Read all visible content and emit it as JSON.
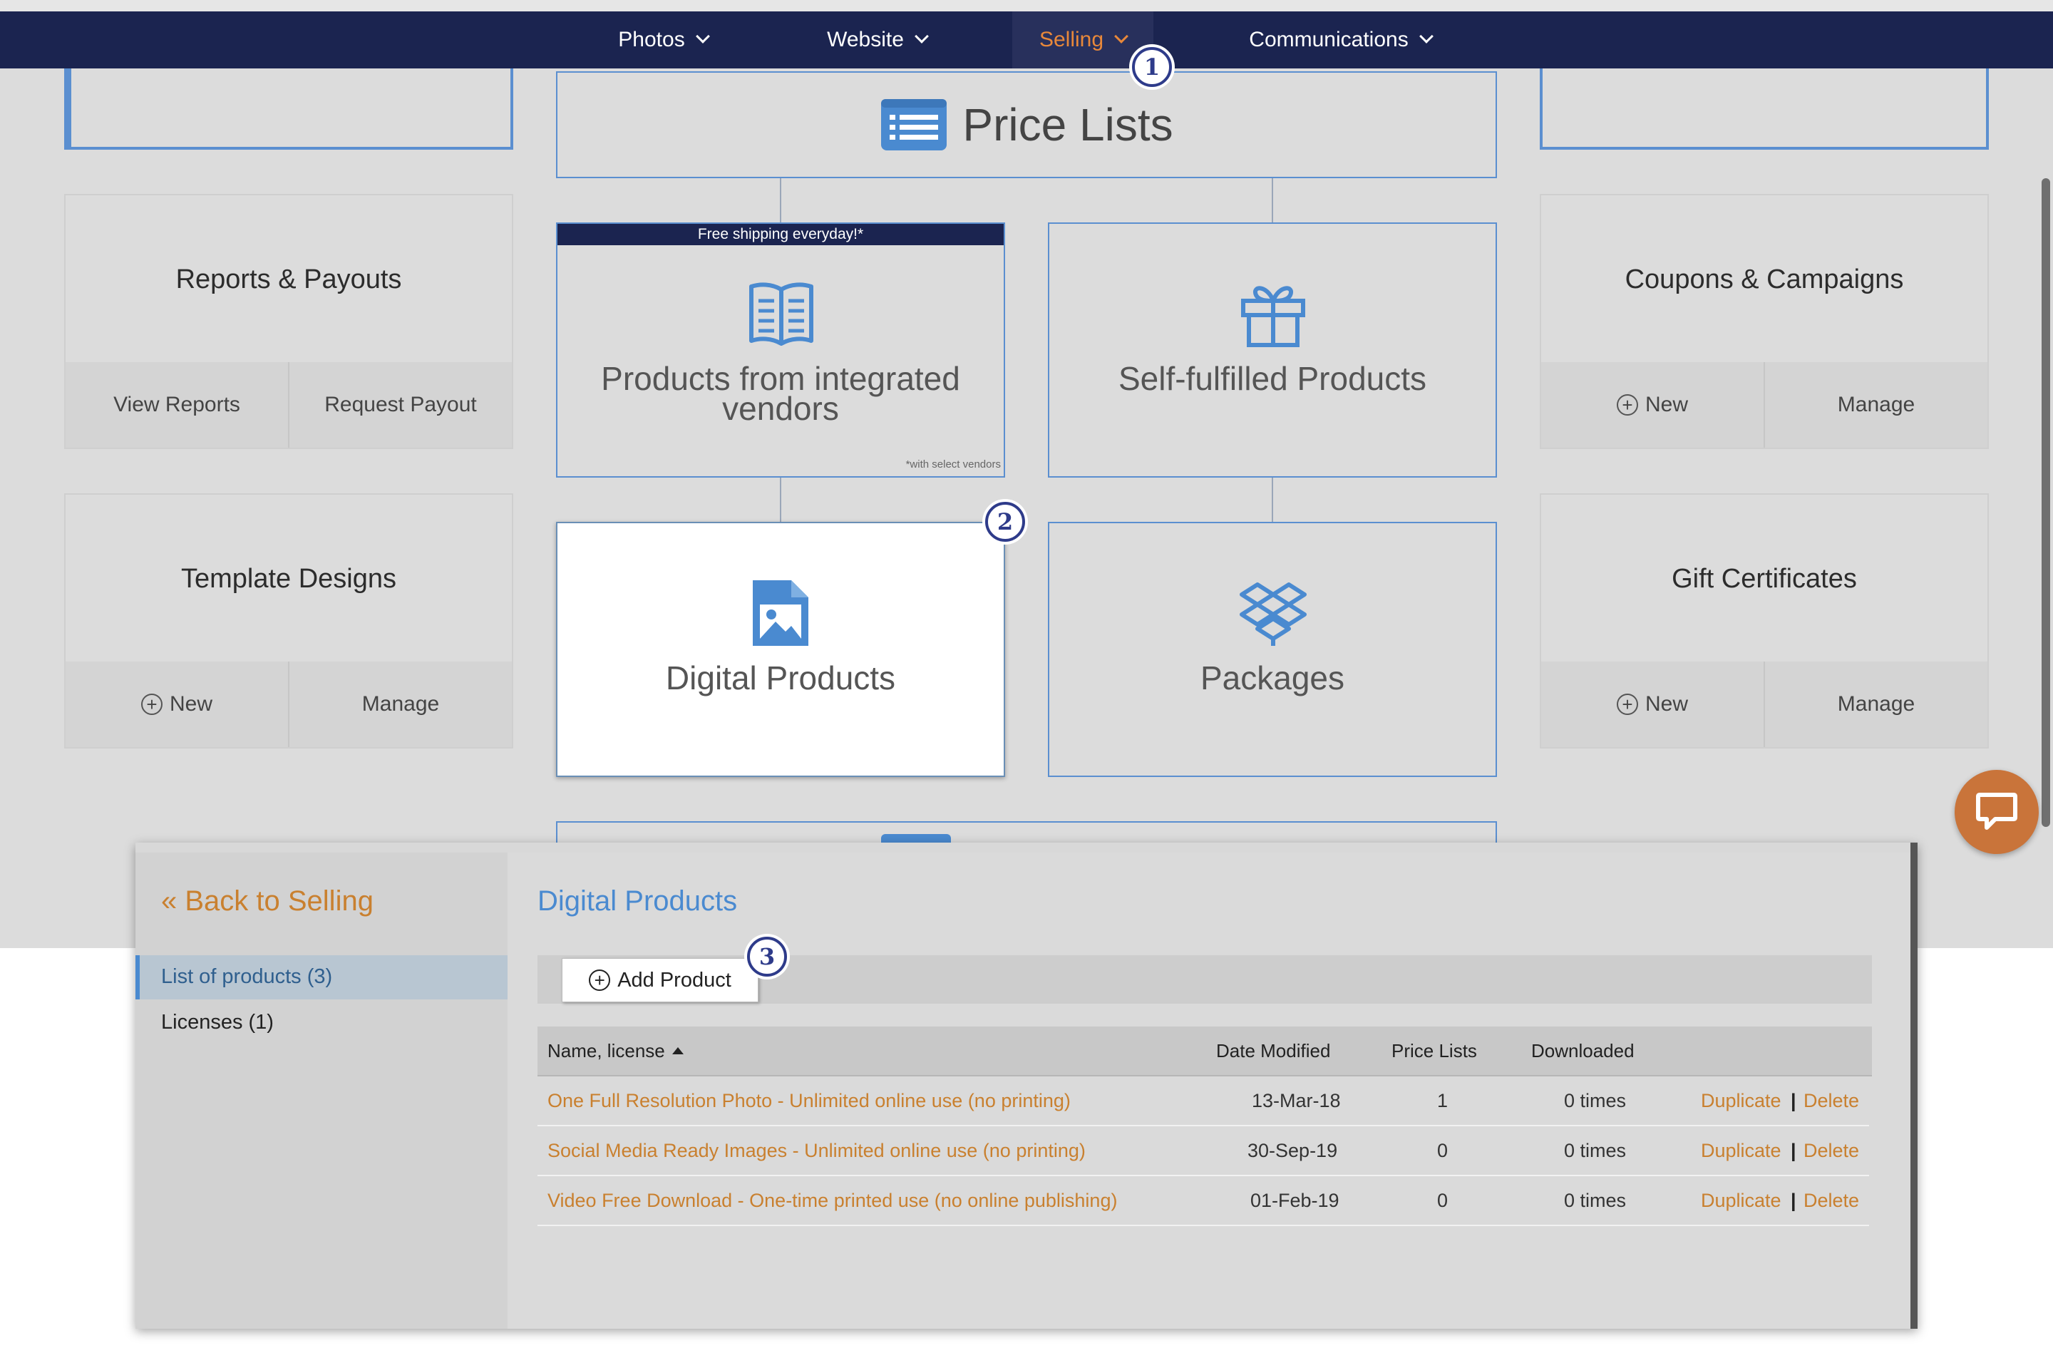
{
  "nav": {
    "items": [
      {
        "label": "Photos"
      },
      {
        "label": "Website"
      },
      {
        "label": "Selling"
      },
      {
        "label": "Communications"
      }
    ],
    "active": "Selling",
    "active_color": "#e8883a",
    "bar_color": "#1b2450"
  },
  "steps": [
    "1",
    "2",
    "3"
  ],
  "price_lists": {
    "title": "Price Lists",
    "icon": "list-icon"
  },
  "cards": {
    "integrated": {
      "banner": "Free shipping everyday!*",
      "label": "Products from integrated vendors",
      "footnote": "*with select vendors",
      "icon": "book-icon"
    },
    "self_fulfilled": {
      "label": "Self-fulfilled Products",
      "icon": "gift-icon"
    },
    "digital": {
      "label": "Digital Products",
      "icon": "image-file-icon"
    },
    "packages": {
      "label": "Packages",
      "icon": "dropbox-icon"
    }
  },
  "left": {
    "reports": {
      "title": "Reports & Payouts",
      "action1": "View Reports",
      "action2": "Request Payout"
    },
    "templates": {
      "title": "Template Designs",
      "action1": "New",
      "action2": "Manage"
    }
  },
  "right": {
    "coupons": {
      "title": "Coupons & Campaigns",
      "action1": "New",
      "action2": "Manage"
    },
    "gifts": {
      "title": "Gift Certificates",
      "action1": "New",
      "action2": "Manage"
    }
  },
  "panel": {
    "back_link": "« Back to Selling",
    "sidebar": [
      {
        "label": "List of products (3)"
      },
      {
        "label": "Licenses (1)"
      }
    ],
    "title": "Digital Products",
    "add_button": "Add Product",
    "columns": [
      "Name, license",
      "Date Modified",
      "Price Lists",
      "Downloaded"
    ],
    "rows": [
      {
        "name": "One Full Resolution Photo - Unlimited online use (no printing)",
        "date": "13-Mar-18",
        "price_lists": "1",
        "downloaded": "0 times",
        "duplicate": "Duplicate",
        "sep": "|",
        "delete": "Delete"
      },
      {
        "name": "Social Media Ready Images - Unlimited online use (no printing)",
        "date": "30-Sep-19",
        "price_lists": "0",
        "downloaded": "0 times",
        "duplicate": "Duplicate",
        "sep": "|",
        "delete": "Delete"
      },
      {
        "name": "Video Free Download - One-time printed use (no online publishing)",
        "date": "01-Feb-19",
        "price_lists": "0",
        "downloaded": "0 times",
        "duplicate": "Duplicate",
        "sep": "|",
        "delete": "Delete"
      }
    ],
    "link_color": "#c9802f",
    "title_color": "#4a8ad0"
  },
  "chat": {
    "icon": "chat-bubble-icon",
    "color": "#c9743a"
  }
}
